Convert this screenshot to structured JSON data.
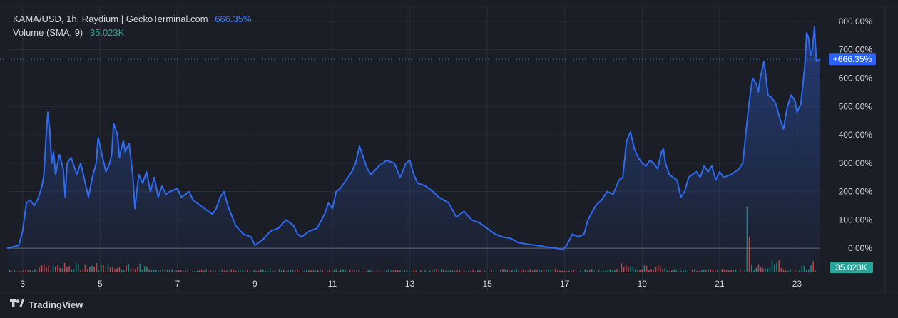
{
  "legend": {
    "pair_line": "KAMA/USD, 1h, Raydium | GeckoTerminal.com",
    "pair_value": "666.35%",
    "volume_line": "Volume (SMA, 9)",
    "volume_value": "35.023K"
  },
  "footer": {
    "brand": "TradingView"
  },
  "colors": {
    "background": "#1b1e27",
    "line": "#2f6bf2",
    "price_badge": "#2962ff",
    "volume_up": "#26a69a",
    "volume_down": "#ef5350",
    "grid": "#2a2e39",
    "text": "#d1d4dc"
  },
  "chart_data": {
    "type": "area",
    "title": "",
    "xlabel": "",
    "ylabel": "",
    "ylim": [
      -85,
      850
    ],
    "xlim": [
      2.6,
      23.6
    ],
    "x_ticks": [
      3,
      5,
      7,
      9,
      11,
      13,
      15,
      17,
      19,
      21,
      23
    ],
    "x_tick_labels": [
      "3",
      "5",
      "7",
      "9",
      "11",
      "13",
      "15",
      "17",
      "19",
      "21",
      "23"
    ],
    "y_ticks": [
      0,
      100,
      200,
      300,
      400,
      500,
      600,
      700,
      800
    ],
    "y_tick_labels": [
      "0.00%",
      "100.00%",
      "200.00%",
      "300.00%",
      "400.00%",
      "500.00%",
      "600.00%",
      "700.00%",
      "800.00%"
    ],
    "grid": true,
    "current_value_label": "+666.35%",
    "volume_label": "35.023K",
    "series": [
      {
        "values": [
          [
            2.6,
            0
          ],
          [
            2.9,
            10
          ],
          [
            3.0,
            60
          ],
          [
            3.1,
            160
          ],
          [
            3.2,
            170
          ],
          [
            3.3,
            150
          ],
          [
            3.4,
            175
          ],
          [
            3.5,
            220
          ],
          [
            3.55,
            260
          ],
          [
            3.6,
            380
          ],
          [
            3.65,
            480
          ],
          [
            3.7,
            420
          ],
          [
            3.75,
            300
          ],
          [
            3.8,
            340
          ],
          [
            3.85,
            260
          ],
          [
            3.95,
            330
          ],
          [
            4.05,
            280
          ],
          [
            4.1,
            180
          ],
          [
            4.15,
            300
          ],
          [
            4.25,
            320
          ],
          [
            4.4,
            260
          ],
          [
            4.5,
            300
          ],
          [
            4.6,
            240
          ],
          [
            4.7,
            180
          ],
          [
            4.8,
            250
          ],
          [
            4.9,
            300
          ],
          [
            4.95,
            390
          ],
          [
            5.05,
            330
          ],
          [
            5.15,
            270
          ],
          [
            5.25,
            300
          ],
          [
            5.3,
            330
          ],
          [
            5.35,
            440
          ],
          [
            5.45,
            400
          ],
          [
            5.5,
            320
          ],
          [
            5.6,
            380
          ],
          [
            5.65,
            340
          ],
          [
            5.75,
            370
          ],
          [
            5.85,
            250
          ],
          [
            5.9,
            140
          ],
          [
            6.0,
            260
          ],
          [
            6.1,
            230
          ],
          [
            6.2,
            270
          ],
          [
            6.3,
            200
          ],
          [
            6.4,
            250
          ],
          [
            6.5,
            180
          ],
          [
            6.6,
            220
          ],
          [
            6.7,
            190
          ],
          [
            6.8,
            200
          ],
          [
            7.0,
            210
          ],
          [
            7.1,
            180
          ],
          [
            7.3,
            200
          ],
          [
            7.4,
            170
          ],
          [
            7.6,
            150
          ],
          [
            7.7,
            140
          ],
          [
            7.9,
            120
          ],
          [
            8.0,
            140
          ],
          [
            8.1,
            180
          ],
          [
            8.2,
            200
          ],
          [
            8.3,
            150
          ],
          [
            8.5,
            80
          ],
          [
            8.7,
            50
          ],
          [
            8.9,
            40
          ],
          [
            9.0,
            10
          ],
          [
            9.2,
            30
          ],
          [
            9.4,
            60
          ],
          [
            9.6,
            70
          ],
          [
            9.8,
            100
          ],
          [
            10.0,
            80
          ],
          [
            10.1,
            50
          ],
          [
            10.2,
            40
          ],
          [
            10.4,
            60
          ],
          [
            10.6,
            70
          ],
          [
            10.8,
            120
          ],
          [
            10.9,
            160
          ],
          [
            11.0,
            140
          ],
          [
            11.1,
            200
          ],
          [
            11.2,
            210
          ],
          [
            11.35,
            240
          ],
          [
            11.5,
            270
          ],
          [
            11.6,
            300
          ],
          [
            11.7,
            360
          ],
          [
            11.8,
            320
          ],
          [
            11.9,
            280
          ],
          [
            12.0,
            260
          ],
          [
            12.2,
            290
          ],
          [
            12.4,
            310
          ],
          [
            12.6,
            300
          ],
          [
            12.75,
            250
          ],
          [
            12.9,
            300
          ],
          [
            13.0,
            310
          ],
          [
            13.1,
            260
          ],
          [
            13.2,
            230
          ],
          [
            13.4,
            220
          ],
          [
            13.6,
            200
          ],
          [
            13.75,
            180
          ],
          [
            14.0,
            160
          ],
          [
            14.2,
            110
          ],
          [
            14.4,
            130
          ],
          [
            14.6,
            100
          ],
          [
            14.8,
            90
          ],
          [
            15.0,
            70
          ],
          [
            15.2,
            50
          ],
          [
            15.4,
            40
          ],
          [
            15.6,
            35
          ],
          [
            15.8,
            20
          ],
          [
            16.0,
            15
          ],
          [
            16.3,
            10
          ],
          [
            16.5,
            5
          ],
          [
            16.8,
            0
          ],
          [
            16.95,
            -5
          ],
          [
            17.05,
            10
          ],
          [
            17.2,
            50
          ],
          [
            17.35,
            40
          ],
          [
            17.5,
            50
          ],
          [
            17.6,
            100
          ],
          [
            17.8,
            150
          ],
          [
            17.95,
            170
          ],
          [
            18.1,
            200
          ],
          [
            18.25,
            190
          ],
          [
            18.4,
            240
          ],
          [
            18.5,
            250
          ],
          [
            18.6,
            380
          ],
          [
            18.7,
            410
          ],
          [
            18.8,
            350
          ],
          [
            18.9,
            320
          ],
          [
            19.0,
            300
          ],
          [
            19.1,
            290
          ],
          [
            19.2,
            310
          ],
          [
            19.3,
            300
          ],
          [
            19.4,
            280
          ],
          [
            19.5,
            340
          ],
          [
            19.55,
            350
          ],
          [
            19.6,
            300
          ],
          [
            19.7,
            260
          ],
          [
            19.8,
            250
          ],
          [
            19.9,
            240
          ],
          [
            20.0,
            180
          ],
          [
            20.1,
            200
          ],
          [
            20.2,
            250
          ],
          [
            20.4,
            270
          ],
          [
            20.5,
            250
          ],
          [
            20.6,
            290
          ],
          [
            20.7,
            270
          ],
          [
            20.8,
            290
          ],
          [
            20.9,
            240
          ],
          [
            21.0,
            270
          ],
          [
            21.1,
            250
          ],
          [
            21.3,
            260
          ],
          [
            21.5,
            280
          ],
          [
            21.6,
            300
          ],
          [
            21.75,
            500
          ],
          [
            21.85,
            600
          ],
          [
            21.95,
            580
          ],
          [
            22.0,
            550
          ],
          [
            22.05,
            600
          ],
          [
            22.15,
            660
          ],
          [
            22.25,
            540
          ],
          [
            22.35,
            530
          ],
          [
            22.45,
            510
          ],
          [
            22.55,
            460
          ],
          [
            22.65,
            420
          ],
          [
            22.75,
            500
          ],
          [
            22.85,
            540
          ],
          [
            22.95,
            520
          ],
          [
            23.0,
            480
          ],
          [
            23.1,
            510
          ],
          [
            23.2,
            640
          ],
          [
            23.25,
            760
          ],
          [
            23.3,
            740
          ],
          [
            23.35,
            680
          ],
          [
            23.4,
            700
          ],
          [
            23.45,
            780
          ],
          [
            23.5,
            660
          ],
          [
            23.6,
            666
          ]
        ]
      }
    ]
  }
}
